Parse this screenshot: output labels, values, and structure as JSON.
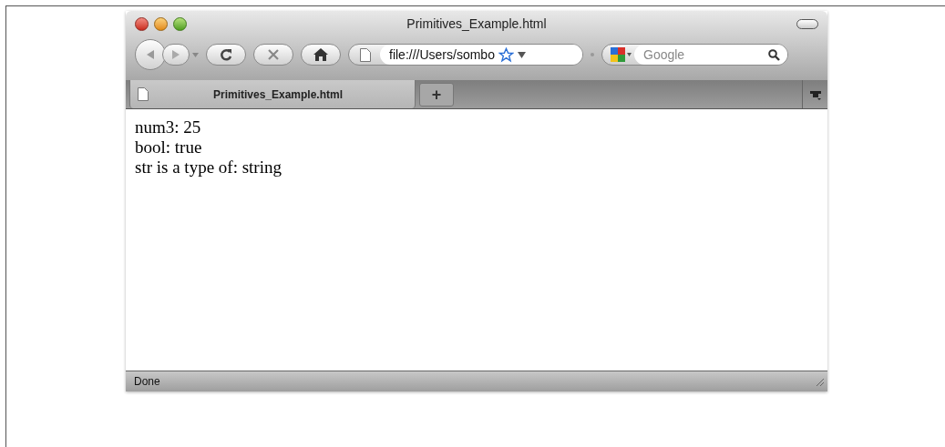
{
  "window": {
    "title": "Primitives_Example.html"
  },
  "toolbar": {
    "address": "file:///Users/sombo",
    "search_placeholder": "Google"
  },
  "tabs": [
    {
      "label": "Primitives_Example.html",
      "selected": true
    }
  ],
  "new_tab": "+",
  "content": {
    "lines": [
      "num3: 25",
      "bool: true",
      "str is a type of: string"
    ]
  },
  "status_bar": "Done"
}
